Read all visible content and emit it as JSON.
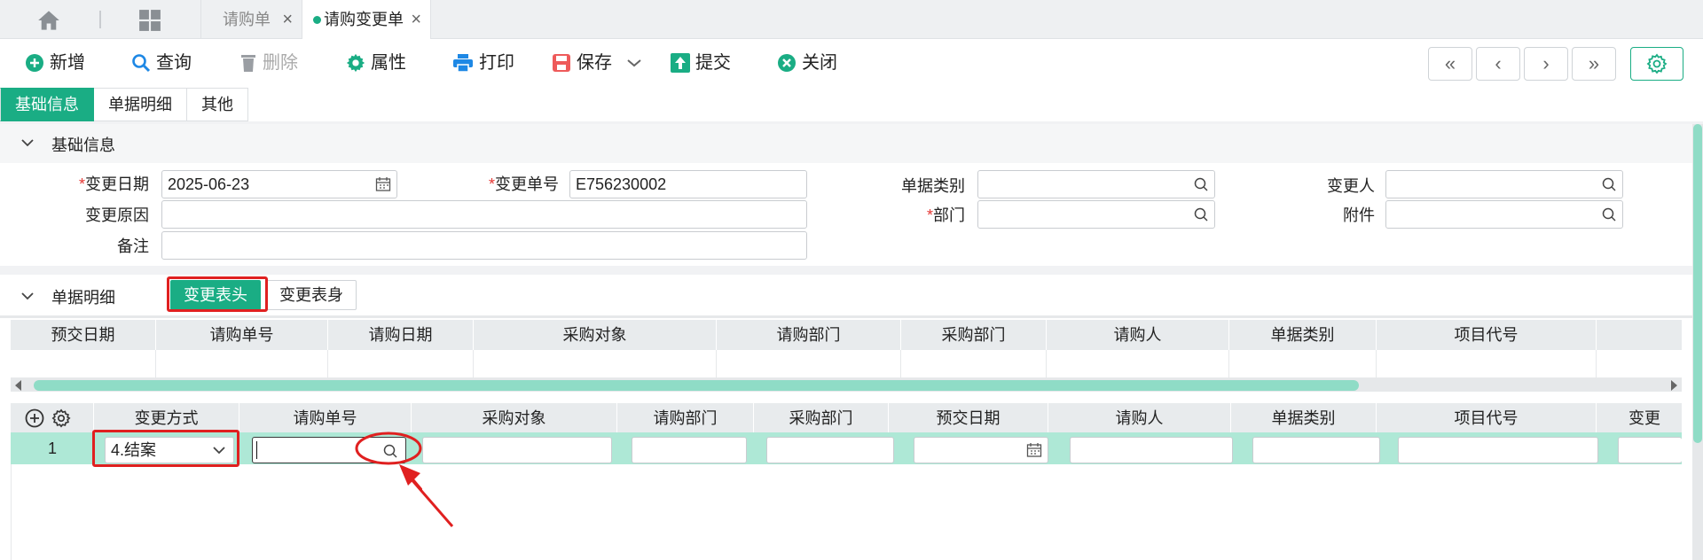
{
  "tabs": [
    {
      "label": "请购单"
    },
    {
      "label": "请购变更单"
    }
  ],
  "toolbar": {
    "new": "新增",
    "query": "查询",
    "delete": "删除",
    "properties": "属性",
    "print": "打印",
    "save": "保存",
    "submit": "提交",
    "close": "关闭"
  },
  "section_tabs": [
    "基础信息",
    "单据明细",
    "其他"
  ],
  "basic": {
    "title": "基础信息",
    "change_date_label": "变更日期",
    "change_date_value": "2025-06-23",
    "change_no_label": "变更单号",
    "change_no_value": "E756230002",
    "doc_type_label": "单据类别",
    "changer_label": "变更人",
    "reason_label": "变更原因",
    "dept_label": "部门",
    "attachment_label": "附件",
    "remark_label": "备注",
    "required_mark": "*"
  },
  "detail": {
    "title": "单据明细",
    "tab_head": "变更表头",
    "tab_body": "变更表身",
    "head_columns": [
      "预交日期",
      "请购单号",
      "请购日期",
      "采购对象",
      "请购部门",
      "采购部门",
      "请购人",
      "单据类别",
      "项目代号"
    ],
    "body_columns": [
      "变更方式",
      "请购单号",
      "采购对象",
      "请购部门",
      "采购部门",
      "预交日期",
      "请购人",
      "单据类别",
      "项目代号",
      "变更"
    ],
    "rows": [
      {
        "index": "1",
        "change_mode": "4.结案"
      }
    ]
  },
  "colors": {
    "accent": "#1aad84",
    "highlight": "#e02020"
  }
}
